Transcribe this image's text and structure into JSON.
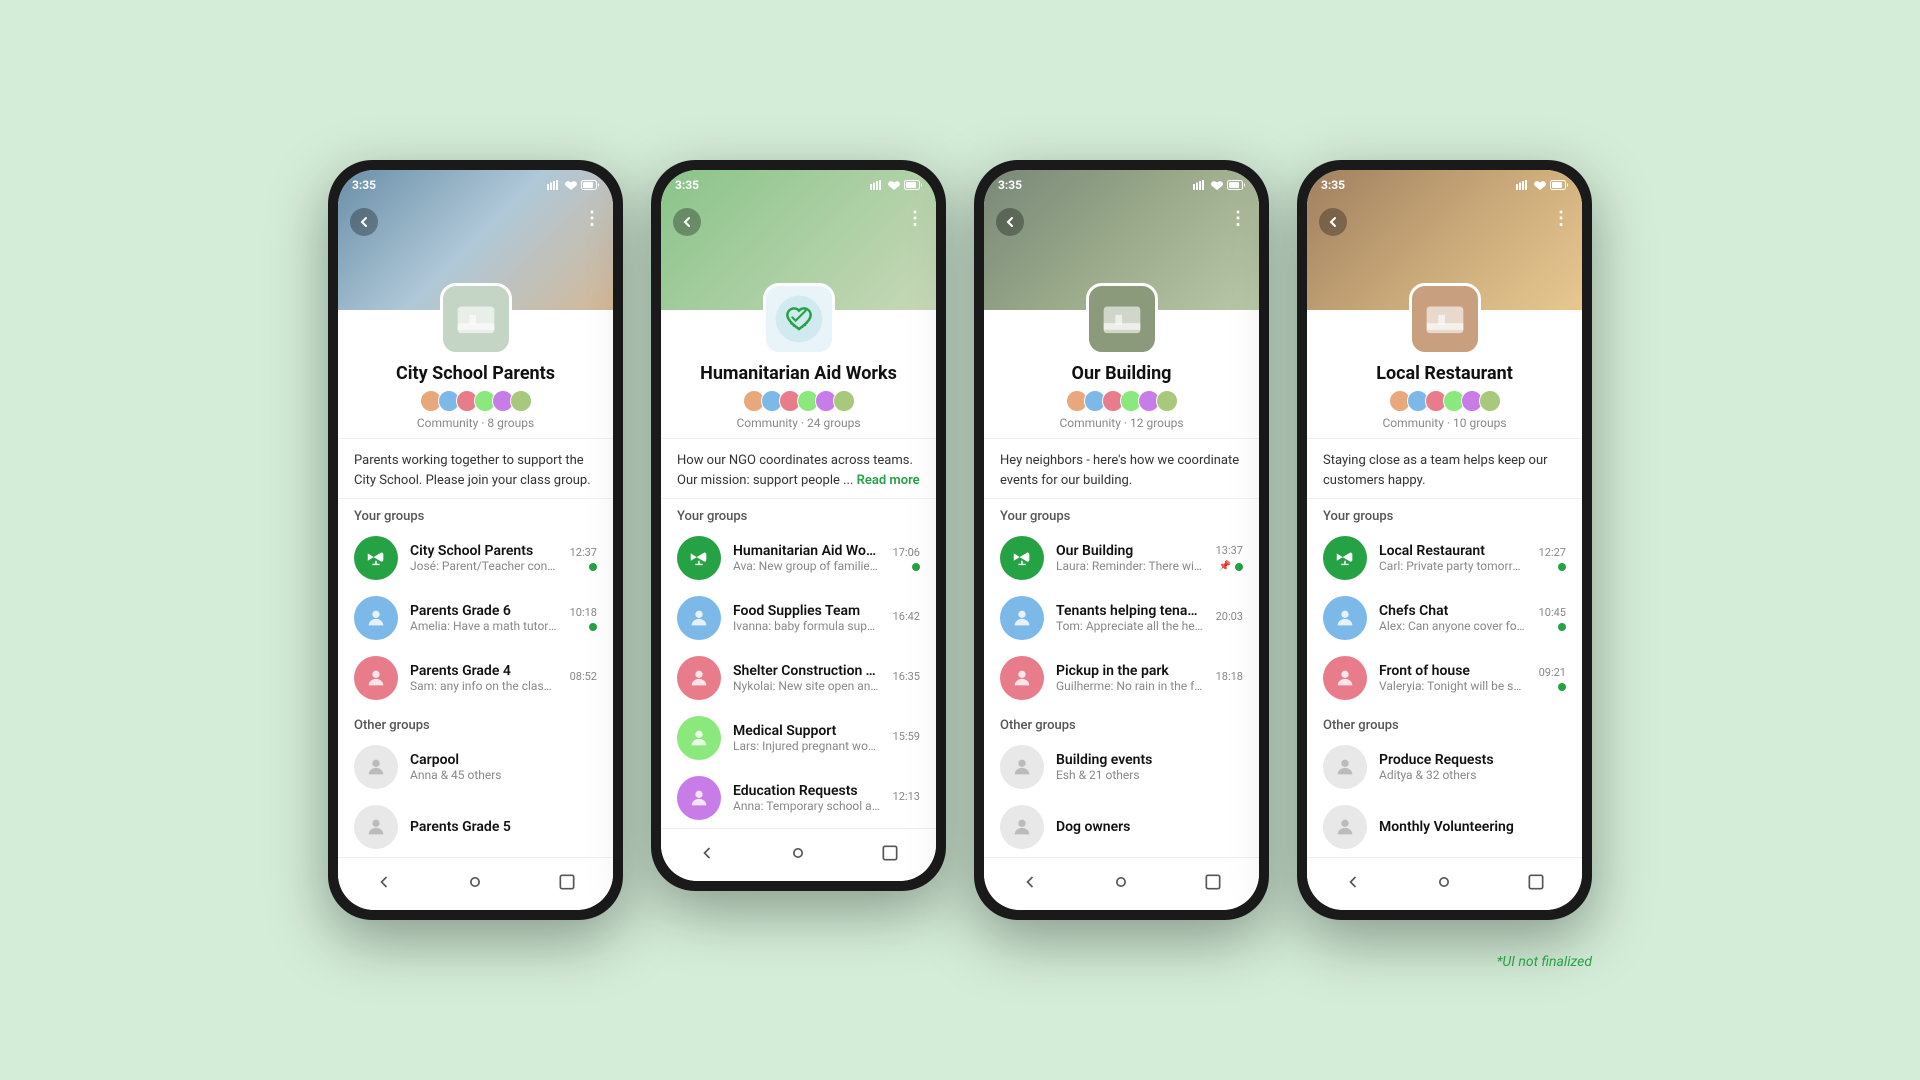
{
  "footnote": "*UI not finalized",
  "phones": [
    {
      "id": "city-school",
      "status_time": "3:35",
      "cover_class": "school-cover",
      "group_name": "City School Parents",
      "community_label": "Community · 8 groups",
      "description": "Parents working together to support the City School. Please join your class group.",
      "your_groups_label": "Your groups",
      "your_groups": [
        {
          "name": "City School Parents",
          "sub": "José: Parent/Teacher conferences ...",
          "time": "12:37",
          "dot": true,
          "pin": false
        },
        {
          "name": "Parents Grade 6",
          "sub": "Amelia: Have a math tutor for the upco...",
          "time": "10:18",
          "dot": true,
          "pin": false
        },
        {
          "name": "Parents Grade 4",
          "sub": "Sam: any info on the class recital?",
          "time": "08:52",
          "dot": false,
          "pin": false
        }
      ],
      "other_groups_label": "Other groups",
      "other_groups": [
        {
          "name": "Carpool",
          "sub": "Anna & 45 others"
        },
        {
          "name": "Parents Grade 5",
          "sub": ""
        }
      ]
    },
    {
      "id": "humanitarian",
      "status_time": "3:35",
      "cover_class": "ngo-cover",
      "group_name": "Humanitarian Aid Works",
      "community_label": "Community · 24 groups",
      "description": "How our NGO coordinates across teams. Our mission: support people ...",
      "read_more": "Read more",
      "your_groups_label": "Your groups",
      "your_groups": [
        {
          "name": "Humanitarian Aid Works",
          "sub": "Ava: New group of families waiting ...",
          "time": "17:06",
          "dot": true,
          "pin": false
        },
        {
          "name": "Food Supplies Team",
          "sub": "Ivanna: baby formula supplies running ...",
          "time": "16:42",
          "dot": false,
          "pin": false
        },
        {
          "name": "Shelter Construction Team",
          "sub": "Nykolai: New site open and ready for ...",
          "time": "16:35",
          "dot": false,
          "pin": false
        },
        {
          "name": "Medical Support",
          "sub": "Lars: Injured pregnant woman in need ...",
          "time": "15:59",
          "dot": false,
          "pin": false
        },
        {
          "name": "Education Requests",
          "sub": "Anna: Temporary school almost comp...",
          "time": "12:13",
          "dot": false,
          "pin": false
        }
      ],
      "other_groups_label": null,
      "other_groups": []
    },
    {
      "id": "our-building",
      "status_time": "3:35",
      "cover_class": "building-cover",
      "group_name": "Our Building",
      "community_label": "Community · 12 groups",
      "description": "Hey neighbors - here's how we coordinate events for our building.",
      "your_groups_label": "Your groups",
      "your_groups": [
        {
          "name": "Our Building",
          "sub": "Laura: Reminder:  There will be ...",
          "time": "13:37",
          "dot": true,
          "pin": true
        },
        {
          "name": "Tenants helping tenants",
          "sub": "Tom: Appreciate all the help!",
          "time": "20:03",
          "dot": false,
          "pin": false
        },
        {
          "name": "Pickup in the park",
          "sub": "Guilherme: No rain in the forecast!",
          "time": "18:18",
          "dot": false,
          "pin": false
        }
      ],
      "other_groups_label": "Other groups",
      "other_groups": [
        {
          "name": "Building events",
          "sub": "Esh & 21 others"
        },
        {
          "name": "Dog owners",
          "sub": ""
        }
      ]
    },
    {
      "id": "local-restaurant",
      "status_time": "3:35",
      "cover_class": "restaurant-cover",
      "group_name": "Local Restaurant",
      "community_label": "Community · 10 groups",
      "description": "Staying close as a team helps keep our customers happy.",
      "your_groups_label": "Your groups",
      "your_groups": [
        {
          "name": "Local Restaurant",
          "sub": "Carl: Private party tomorrow in the ...",
          "time": "12:27",
          "dot": true,
          "pin": false
        },
        {
          "name": "Chefs Chat",
          "sub": "Alex: Can anyone cover for me?",
          "time": "10:45",
          "dot": true,
          "pin": false
        },
        {
          "name": "Front of house",
          "sub": "Valeryia: Tonight will be special!",
          "time": "09:21",
          "dot": true,
          "pin": false
        }
      ],
      "other_groups_label": "Other groups",
      "other_groups": [
        {
          "name": "Produce Requests",
          "sub": "Aditya & 32 others"
        },
        {
          "name": "Monthly Volunteering",
          "sub": ""
        }
      ]
    }
  ]
}
